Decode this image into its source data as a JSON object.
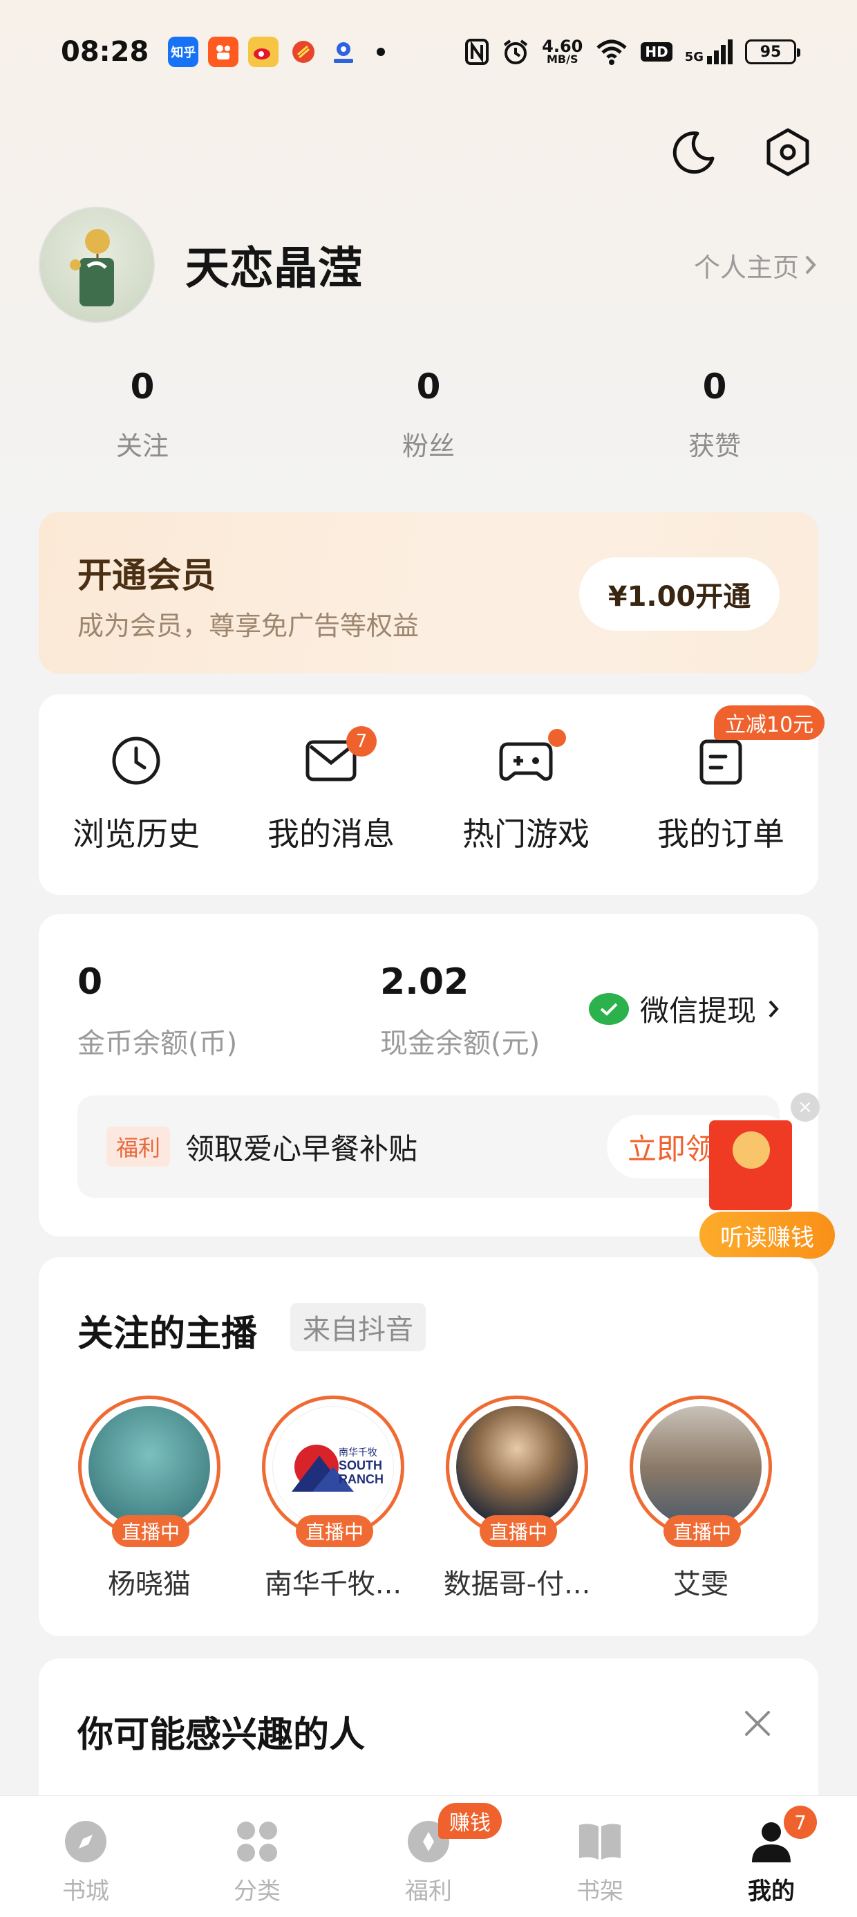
{
  "status_bar": {
    "time": "08:28",
    "app_icons": [
      {
        "name": "zhihu-icon",
        "text": "知乎",
        "color": "#1772f6"
      },
      {
        "name": "kuaishou-icon",
        "text": "",
        "color": "#ff5a1f"
      },
      {
        "name": "weibo-icon",
        "text": "",
        "color": "#f6c543"
      },
      {
        "name": "app-red-icon",
        "text": "",
        "color": "#e8452c"
      },
      {
        "name": "app-blue-icon",
        "text": "",
        "color": "#2d63e0"
      }
    ],
    "net_speed_value": "4.60",
    "net_speed_unit": "MB/S",
    "hd_label": "HD",
    "network_label": "5G",
    "battery": "95"
  },
  "profile": {
    "username": "天恋晶滢",
    "homepage_link": "个人主页"
  },
  "stats": [
    {
      "value": "0",
      "label": "关注"
    },
    {
      "value": "0",
      "label": "粉丝"
    },
    {
      "value": "0",
      "label": "获赞"
    }
  ],
  "vip": {
    "title": "开通会员",
    "subtitle": "成为会员，尊享免广告等权益",
    "button": "¥1.00开通"
  },
  "quick_actions": [
    {
      "label": "浏览历史",
      "badge": ""
    },
    {
      "label": "我的消息",
      "badge": "7"
    },
    {
      "label": "热门游戏",
      "badge": ""
    },
    {
      "label": "我的订单",
      "badge": "立减10元"
    }
  ],
  "wallet": {
    "coin_value": "0",
    "coin_label": "金币余额(币)",
    "cash_value": "2.02",
    "cash_label": "现金余额(元)",
    "withdraw": "微信提现",
    "welfare_tag": "福利",
    "welfare_text": "领取爱心早餐补贴",
    "claim_button": "立即领取"
  },
  "floating_packet": {
    "label": "听读赚钱",
    "close": "×"
  },
  "anchors_section": {
    "title": "关注的主播",
    "source": "来自抖音",
    "live_label": "直播中",
    "items": [
      {
        "name": "杨晓猫",
        "color": "#3f8a8c"
      },
      {
        "name": "南华千牧...",
        "color": "#ffffff"
      },
      {
        "name": "数据哥-付...",
        "color": "#6b5640"
      },
      {
        "name": "艾雯",
        "color": "#9a8a7a"
      }
    ]
  },
  "interest_section": {
    "title": "你可能感兴趣的人"
  },
  "tabbar": {
    "tabs": [
      {
        "label": "书城",
        "badge": ""
      },
      {
        "label": "分类",
        "badge": ""
      },
      {
        "label": "福利",
        "badge": "赚钱"
      },
      {
        "label": "书架",
        "badge": ""
      },
      {
        "label": "我的",
        "badge": "7"
      }
    ],
    "active_index": 4
  }
}
